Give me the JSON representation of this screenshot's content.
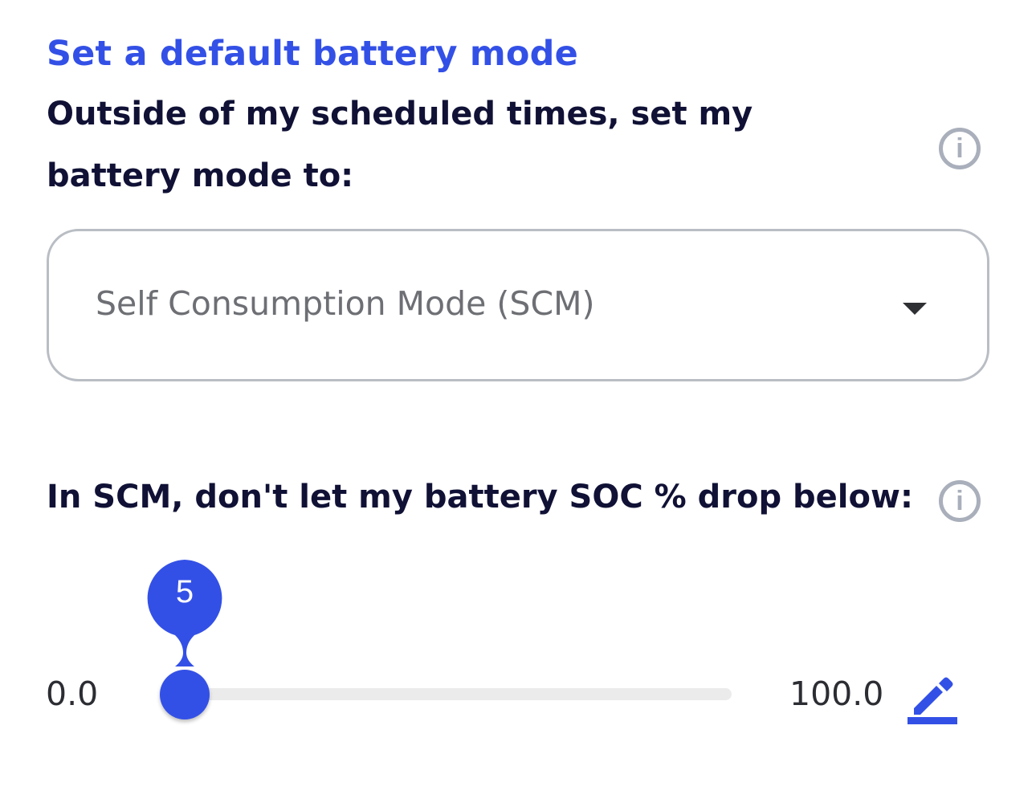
{
  "default_mode": {
    "title": "Set a default battery mode",
    "question": "Outside of my scheduled times, set my battery mode to:",
    "select": {
      "selected_value": "Self Consumption Mode (SCM)"
    },
    "info_icon": "info-icon"
  },
  "soc_limit": {
    "question": "In SCM, don't let my battery SOC % drop below:",
    "info_icon": "info-icon",
    "slider": {
      "min_label": "0.0",
      "max_label": "100.0",
      "min": 0,
      "max": 100,
      "value": 5,
      "value_label": "5"
    },
    "edit_icon": "pencil-edit-icon"
  },
  "colors": {
    "accent": "#3350e6",
    "heading_text": "#101135",
    "muted_text": "#6d6f74",
    "border": "#b9bdc4",
    "track": "#ebebeb",
    "info_icon": "#a9afbb"
  }
}
